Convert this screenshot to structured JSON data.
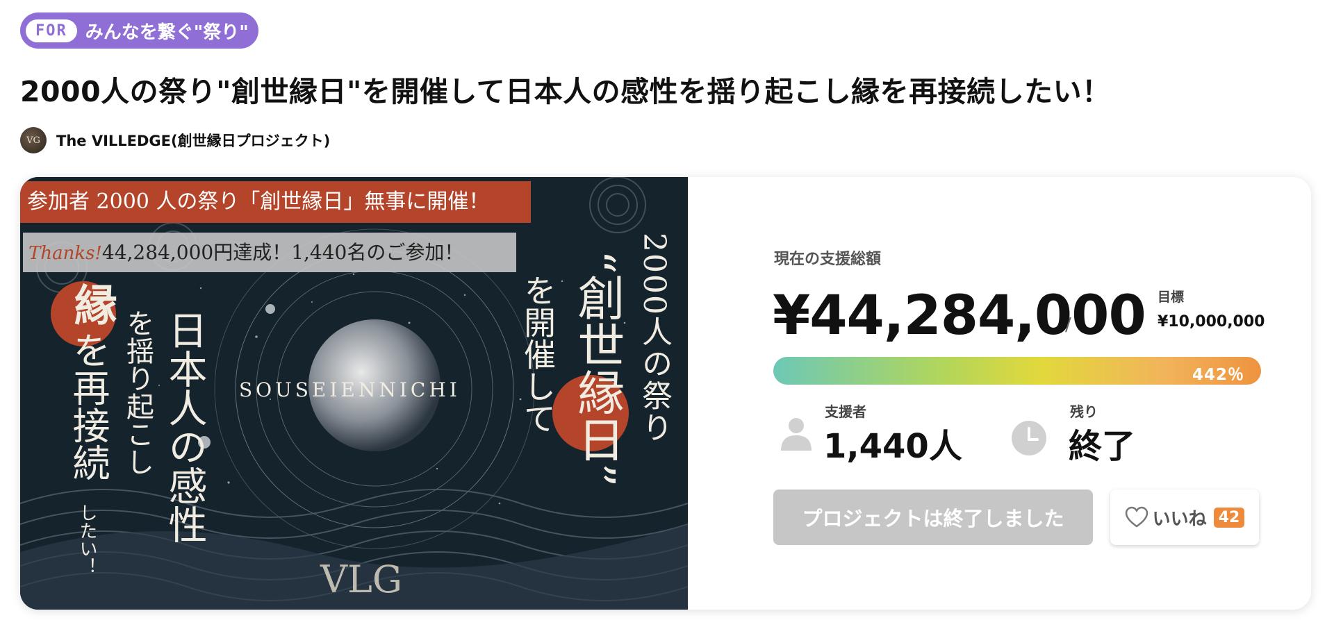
{
  "tag": {
    "prefix": "FOR",
    "text": "みんなを繋ぐ\"祭り\""
  },
  "title": "2000人の祭り\"創世縁日\"を開催して日本人の感性を揺り起こし縁を再接続したい！",
  "owner": {
    "avatar_text": "VG",
    "name": "The VILLEDGE(創世縁日プロジェクト)"
  },
  "hero": {
    "banner_top": "参加者 2000 人の祭り「創世縁日」無事に開催！",
    "banner_thanks": "Thanks!",
    "banner_second": "44,284,000円達成！1,440名のご参加！",
    "left_circle_char": "縁",
    "left_col1": "を再接続",
    "left_col1b": "したい！",
    "left_col2": "を揺り起こし",
    "left_col3": "日本人の感性",
    "center_text": "SOUSEIENNICHI",
    "right_col1": "を開催して",
    "right_col2": "“創世縁日”",
    "right_col3": "2000人の祭り",
    "logo": "VLG"
  },
  "funding": {
    "total_label": "現在の支援総額",
    "total_amount": "¥44,284,000",
    "slash": "/",
    "goal_label": "目標",
    "goal_amount": "¥10,000,000",
    "percent_text": "442％",
    "percent_value": 442
  },
  "stats": {
    "supporters_label": "支援者",
    "supporters_value": "1,440人",
    "remaining_label": "残り",
    "remaining_value": "終了"
  },
  "actions": {
    "ended_label": "プロジェクトは終了しました",
    "like_label": "いいね",
    "like_count": "42"
  },
  "colors": {
    "tag": "#8f6fd6",
    "accent_red": "#b4452b",
    "like_badge": "#ee8a3a",
    "disabled": "#c6c6c6"
  }
}
